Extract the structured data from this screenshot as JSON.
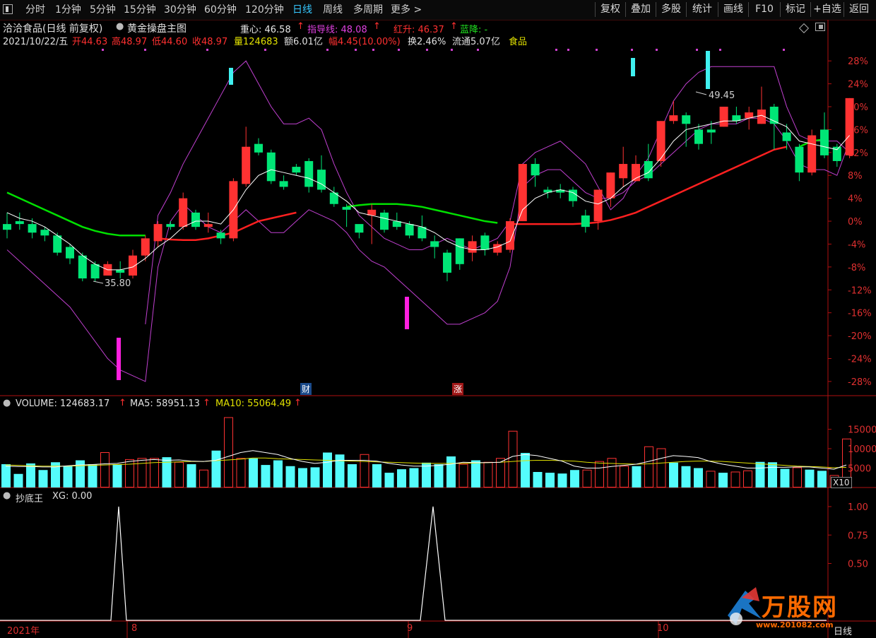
{
  "toolbar": {
    "tabs": [
      "分时",
      "1分钟",
      "5分钟",
      "15分钟",
      "30分钟",
      "60分钟",
      "120分钟",
      "日线",
      "周线",
      "多周期",
      "更多 >"
    ],
    "active_tab": "日线",
    "right_buttons": [
      "复权",
      "叠加",
      "多股",
      "统计",
      "画线",
      "F10",
      "标记",
      "+自选",
      "返回"
    ]
  },
  "header": {
    "stock_title": "洽洽食品(日线 前复权)",
    "indicator_name": "黄金操盘主图",
    "center_label": "重心: 46.58",
    "guide_label": "指导线: 48.08",
    "red_rise_label": "红升: 46.37",
    "blue_fall_label": "蓝降: -",
    "date": "2021/10/22/五",
    "open": "开44.63",
    "high": "高48.97",
    "low": "低44.60",
    "close": "收48.97",
    "volume": "量124683",
    "amount": "额6.01亿",
    "change": "幅4.45(10.00%)",
    "turnover": "换2.46%",
    "float": "流通5.07亿",
    "sector": "食品"
  },
  "volume_header": {
    "volume": "VOLUME: 124683.17",
    "ma5": "MA5: 58951.13",
    "ma10": "MA10: 55064.49"
  },
  "indicator_header": {
    "name": "抄底王",
    "xg": "XG: 0.00"
  },
  "markers": {
    "cai": "财",
    "zhang": "涨",
    "low_label": "35.80",
    "high_label": "49.45",
    "x10": "X10"
  },
  "footer": {
    "year": "2021年",
    "m8": "8",
    "m9": "9",
    "m10": "10",
    "period": "日线"
  },
  "watermark": {
    "brand": "万股网",
    "url": "www.201082.com"
  },
  "colors": {
    "up": "#ff3232",
    "down": "#00e676",
    "vol_down": "#54fcfc",
    "ma_green": "#00e000",
    "ma_red": "#ff2020",
    "band": "#c040d0",
    "axis": "#b01010"
  },
  "chart_data": [
    {
      "type": "candlestick",
      "y_axis_ticks": [
        "28%",
        "24%",
        "20%",
        "16%",
        "12%",
        "8%",
        "4%",
        "0%",
        "-4%",
        "-8%",
        "-12%",
        "-16%",
        "-20%",
        "-24%",
        "-28%"
      ],
      "ylim": [
        -29,
        30
      ],
      "candles": [
        [
          -0.5,
          -1.5,
          1.5,
          -3.0
        ],
        [
          0.0,
          -0.5,
          1.5,
          -1.5
        ],
        [
          -0.5,
          -2.0,
          0.5,
          -3.0
        ],
        [
          -1.5,
          -2.5,
          -1.0,
          -3.5
        ],
        [
          -2.5,
          -5.5,
          -2.0,
          -6.0
        ],
        [
          -4.5,
          -6.5,
          -4.0,
          -7.5
        ],
        [
          -6.0,
          -10.0,
          -5.5,
          -10.5
        ],
        [
          -7.5,
          -10.0,
          -7.0,
          -10.5
        ],
        [
          -9.5,
          -7.5,
          -7.0,
          -9.5
        ],
        [
          -8.5,
          -9.0,
          -7.0,
          -10.0
        ],
        [
          -9.5,
          -6.0,
          -5.0,
          -10.0
        ],
        [
          -6.0,
          -3.0,
          -2.5,
          -7.0
        ],
        [
          -3.5,
          -0.5,
          0.0,
          -4.5
        ],
        [
          -0.5,
          -1.0,
          0.0,
          -1.5
        ],
        [
          -1.0,
          4.0,
          5.0,
          -1.5
        ],
        [
          1.5,
          -1.0,
          2.0,
          -1.5
        ],
        [
          -1.0,
          -0.5,
          1.5,
          -2.0
        ],
        [
          -2.0,
          -3.0,
          -1.5,
          -4.0
        ],
        [
          -3.0,
          7.0,
          7.5,
          -3.5
        ],
        [
          6.5,
          13.0,
          16.5,
          6.0
        ],
        [
          13.5,
          12.0,
          14.5,
          11.5
        ],
        [
          12.0,
          7.0,
          12.5,
          6.5
        ],
        [
          7.0,
          6.0,
          8.0,
          5.5
        ],
        [
          9.5,
          8.5,
          10.0,
          8.0
        ],
        [
          10.5,
          6.0,
          11.0,
          5.0
        ],
        [
          9.0,
          5.5,
          11.5,
          5.0
        ],
        [
          5.0,
          3.0,
          6.0,
          2.5
        ],
        [
          2.5,
          2.0,
          3.0,
          -1.0
        ],
        [
          -0.5,
          -2.0,
          -1.0,
          -3.0
        ],
        [
          1.0,
          2.0,
          3.0,
          -4.0
        ],
        [
          1.5,
          -1.5,
          2.0,
          -2.0
        ],
        [
          0.0,
          -1.0,
          1.5,
          -1.5
        ],
        [
          -0.5,
          -2.5,
          0.0,
          -3.0
        ],
        [
          -1.0,
          -3.0,
          1.0,
          -3.5
        ],
        [
          -3.5,
          -4.5,
          -2.5,
          -6.5
        ],
        [
          -5.5,
          -9.0,
          -5.0,
          -10.5
        ],
        [
          -3.0,
          -7.5,
          -3.0,
          -8.5
        ],
        [
          -5.5,
          -3.5,
          -2.5,
          -7.0
        ],
        [
          -2.5,
          -5.0,
          -2.0,
          -6.0
        ],
        [
          -5.5,
          -4.0,
          -3.5,
          -6.0
        ],
        [
          -5.0,
          0.0,
          0.5,
          -5.5
        ],
        [
          0.0,
          10.0,
          10.0,
          0.0
        ],
        [
          10.0,
          8.0,
          11.0,
          6.0
        ],
        [
          5.5,
          5.0,
          6.0,
          4.0
        ],
        [
          5.5,
          5.0,
          6.5,
          4.0
        ],
        [
          5.5,
          3.5,
          6.0,
          2.5
        ],
        [
          1.0,
          -1.0,
          2.0,
          -2.0
        ],
        [
          0.0,
          5.5,
          5.5,
          -1.5
        ],
        [
          4.0,
          8.5,
          8.5,
          2.5
        ],
        [
          7.5,
          10.0,
          13.0,
          6.0
        ],
        [
          7.0,
          10.0,
          11.5,
          7.0
        ],
        [
          10.5,
          7.5,
          13.5,
          7.0
        ],
        [
          10.5,
          17.5,
          17.5,
          9.5
        ],
        [
          17.5,
          18.5,
          21.0,
          17.0
        ],
        [
          18.5,
          17.0,
          19.0,
          13.0
        ],
        [
          16.0,
          13.5,
          17.0,
          12.5
        ],
        [
          16.0,
          15.5,
          17.5,
          13.5
        ],
        [
          16.5,
          20.0,
          20.0,
          16.5
        ],
        [
          18.5,
          17.5,
          20.0,
          17.0
        ],
        [
          18.0,
          19.0,
          20.0,
          16.0
        ],
        [
          17.0,
          19.5,
          23.5,
          17.0
        ],
        [
          20.0,
          17.0,
          20.5,
          12.5
        ],
        [
          15.5,
          14.0,
          17.0,
          12.5
        ],
        [
          13.0,
          8.5,
          13.5,
          7.0
        ],
        [
          8.5,
          15.0,
          16.0,
          8.0
        ],
        [
          16.0,
          11.5,
          19.0,
          11.0
        ],
        [
          13.0,
          10.5,
          13.5,
          9.5
        ],
        [
          11.5,
          21.5,
          21.5,
          11.0
        ]
      ],
      "ma_white": [
        1.5,
        0.5,
        0.0,
        -1.0,
        -2.5,
        -4.0,
        -6.0,
        -7.5,
        -8.5,
        -8.5,
        -8.0,
        -6.5,
        -4.5,
        -3.0,
        -1.0,
        0.0,
        0.0,
        -0.5,
        2.0,
        5.5,
        8.0,
        9.0,
        8.5,
        8.0,
        7.5,
        6.5,
        5.0,
        3.5,
        1.5,
        1.0,
        0.5,
        0.0,
        -0.5,
        -1.0,
        -2.0,
        -3.5,
        -4.5,
        -5.0,
        -5.0,
        -4.5,
        -3.5,
        2.0,
        4.0,
        5.0,
        5.5,
        5.0,
        3.5,
        3.0,
        4.0,
        6.0,
        7.5,
        8.5,
        11.0,
        14.0,
        16.0,
        16.5,
        17.0,
        17.5,
        17.5,
        18.0,
        18.5,
        17.5,
        16.5,
        14.0,
        13.5,
        13.0,
        12.5,
        15.0
      ],
      "ma_green": [
        5.0,
        4.0,
        3.0,
        2.0,
        1.0,
        0.0,
        -1.0,
        -1.7,
        -2.2,
        -2.5,
        -2.5,
        -2.5,
        null,
        null,
        null,
        null,
        null,
        null,
        null,
        null,
        null,
        null,
        null,
        null,
        null,
        null,
        null,
        2.5,
        2.8,
        3.0,
        3.0,
        3.0,
        2.8,
        2.5,
        2.0,
        1.5,
        1.0,
        0.5,
        0.0,
        -0.3,
        null,
        null,
        null,
        null,
        null,
        null,
        null,
        null,
        null,
        null,
        null,
        null,
        null,
        null,
        null,
        null,
        null,
        null,
        null,
        null,
        null,
        null,
        null,
        13.0,
        14.0,
        14.3,
        null,
        null
      ],
      "ma_red": [
        null,
        null,
        null,
        null,
        null,
        null,
        null,
        null,
        null,
        null,
        null,
        null,
        -3.0,
        -3.2,
        -3.3,
        -3.3,
        -3.0,
        -2.5,
        -2.0,
        -1.0,
        0.0,
        0.5,
        1.0,
        1.5,
        null,
        null,
        null,
        null,
        null,
        null,
        null,
        null,
        null,
        null,
        null,
        null,
        null,
        null,
        null,
        null,
        -0.5,
        -0.5,
        -0.5,
        -0.5,
        -0.5,
        -0.5,
        -0.4,
        -0.2,
        0.2,
        0.8,
        1.5,
        2.5,
        3.5,
        4.5,
        5.5,
        6.5,
        7.5,
        8.5,
        9.5,
        10.5,
        11.5,
        12.5,
        13.0,
        null,
        null,
        null,
        null,
        null
      ],
      "band_upper": [
        null,
        null,
        null,
        null,
        null,
        null,
        null,
        null,
        null,
        null,
        null,
        -18,
        1,
        5,
        10,
        14,
        18,
        22,
        26,
        28,
        24,
        20,
        17,
        17,
        18,
        16,
        10,
        5,
        1,
        -1,
        -3,
        -4,
        -5,
        -5,
        -4,
        -3,
        -4,
        -5,
        -4,
        -3,
        0,
        10,
        12,
        13,
        14,
        12,
        10,
        6,
        2,
        4,
        8,
        11,
        16,
        21,
        24,
        26,
        27,
        27,
        27,
        27,
        27,
        27,
        20,
        15,
        14,
        14,
        14,
        12
      ],
      "band_lower": [
        -5,
        -7,
        -9,
        -11,
        -13,
        -15,
        -18,
        -21,
        -24,
        -26,
        -27,
        -28,
        -8,
        0,
        3,
        1,
        -1,
        -2,
        0,
        2,
        0,
        -2,
        -2,
        0,
        2,
        1,
        0,
        -2,
        -5,
        -7,
        -8,
        -10,
        -12,
        -14,
        -16,
        -18,
        -18,
        -17,
        -16,
        -14,
        -8,
        6,
        8,
        9,
        9,
        7,
        5,
        4,
        4,
        5,
        7,
        8,
        10,
        12,
        14,
        16,
        17,
        17,
        17,
        18,
        18,
        17,
        14,
        10,
        9,
        9,
        8,
        14
      ]
    },
    {
      "type": "bar",
      "series_name": "VOLUME",
      "y_axis_ticks": [
        "15000",
        "10000",
        "5000"
      ],
      "values": [
        6000,
        3500,
        6200,
        4500,
        6500,
        5500,
        7000,
        6000,
        9000,
        6000,
        7200,
        7500,
        7500,
        7800,
        6500,
        6000,
        4500,
        9500,
        18000,
        7500,
        7500,
        5800,
        7000,
        5500,
        5000,
        5200,
        9000,
        8500,
        6000,
        8500,
        6000,
        3800,
        4700,
        5000,
        6400,
        6000,
        8000,
        6000,
        7000,
        6500,
        7500,
        14500,
        8900,
        4000,
        3800,
        3600,
        4500,
        4500,
        6700,
        7500,
        5500,
        5500,
        10500,
        10000,
        6400,
        5500,
        5000,
        4200,
        3800,
        4000,
        4300,
        6600,
        6500,
        4800,
        5100,
        4600,
        4300,
        3100,
        12500
      ],
      "ma_white": [
        5500,
        5400,
        5400,
        5300,
        5300,
        5600,
        5800,
        5900,
        6100,
        6200,
        6700,
        7000,
        7200,
        7000,
        7100,
        6800,
        6700,
        7000,
        8000,
        9000,
        9500,
        9000,
        8500,
        7500,
        6700,
        6200,
        6500,
        7000,
        7000,
        7000,
        6800,
        6200,
        5800,
        5500,
        5500,
        5700,
        6000,
        6500,
        6400,
        6400,
        6500,
        8000,
        8500,
        8200,
        7500,
        6800,
        5500,
        5000,
        5000,
        5400,
        5700,
        6000,
        6700,
        7500,
        8200,
        8000,
        7700,
        6700,
        6000,
        5500,
        5000,
        5000,
        5200,
        5200,
        5300,
        5300,
        5000,
        4700,
        5800
      ],
      "ma_yellow": [
        5800,
        5700,
        5600,
        5500,
        5500,
        5500,
        5600,
        5700,
        5800,
        5900,
        6000,
        6200,
        6400,
        6500,
        6600,
        6700,
        6700,
        6900,
        7100,
        7300,
        7600,
        7600,
        7400,
        7300,
        7200,
        7100,
        7000,
        6900,
        6800,
        6700,
        6600,
        6500,
        6400,
        6300,
        6200,
        6200,
        6200,
        6200,
        6300,
        6400,
        6500,
        6700,
        6900,
        7000,
        7000,
        6900,
        6800,
        6500,
        6300,
        6200,
        6100,
        6000,
        6100,
        6300,
        6500,
        6700,
        6800,
        6800,
        6700,
        6500,
        6300,
        6100,
        5900,
        5700,
        5500,
        5400,
        5300,
        5100,
        5200
      ]
    },
    {
      "type": "line",
      "series_name": "XG",
      "y_axis_ticks": [
        "1.00",
        "0.75",
        "0.50"
      ],
      "x": [
        0,
        157,
        168,
        179,
        595,
        613,
        630,
        1170
      ],
      "values": [
        0,
        0,
        1,
        0,
        0,
        1,
        0,
        0
      ]
    }
  ]
}
